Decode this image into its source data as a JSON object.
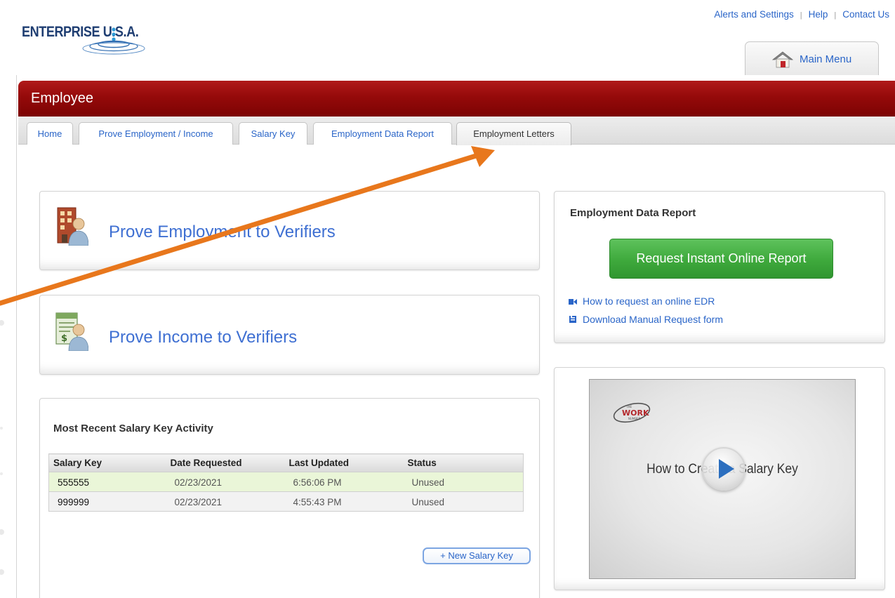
{
  "top_links": {
    "alerts": "Alerts and Settings",
    "separator": "|",
    "help": "Help",
    "contact": "Contact Us"
  },
  "logo": {
    "text": "ENTERPRISE U.S.A."
  },
  "main_menu": {
    "label": "Main Menu",
    "icon": "house-icon"
  },
  "header": {
    "title": "Employee"
  },
  "tabs": [
    {
      "label": "Home"
    },
    {
      "label": "Prove Employment / Income"
    },
    {
      "label": "Salary Key"
    },
    {
      "label": "Employment Data Report"
    },
    {
      "label": "Employment Letters",
      "active": true
    }
  ],
  "prove_employment": {
    "title": "Prove Employment to Verifiers",
    "icon": "building-person-icon"
  },
  "prove_income": {
    "title": "Prove Income to Verifiers",
    "icon": "money-person-icon"
  },
  "salary_activity": {
    "title": "Most Recent Salary Key Activity",
    "columns": [
      "Salary Key",
      "Date Requested",
      "Last Updated",
      "Status"
    ],
    "rows": [
      [
        "555555",
        "02/23/2021",
        "6:56:06 PM",
        "Unused"
      ],
      [
        "999999",
        "02/23/2021",
        "4:55:43 PM",
        "Unused"
      ]
    ],
    "new_button": "+ New Salary Key"
  },
  "edr": {
    "title": "Employment Data Report",
    "button": "Request Instant Online Report",
    "link_video": "How to request an online EDR",
    "link_download": "Download Manual Request form"
  },
  "video": {
    "title": "How to Create a Salary Key",
    "logo": "THE WORK NUMBER"
  },
  "colors": {
    "accent_red": "#950a0a",
    "link_blue": "#2a65c8",
    "button_green": "#3ea93c",
    "annotation_arrow": "#e8771c",
    "highlight_row": "#eaf6d8"
  }
}
